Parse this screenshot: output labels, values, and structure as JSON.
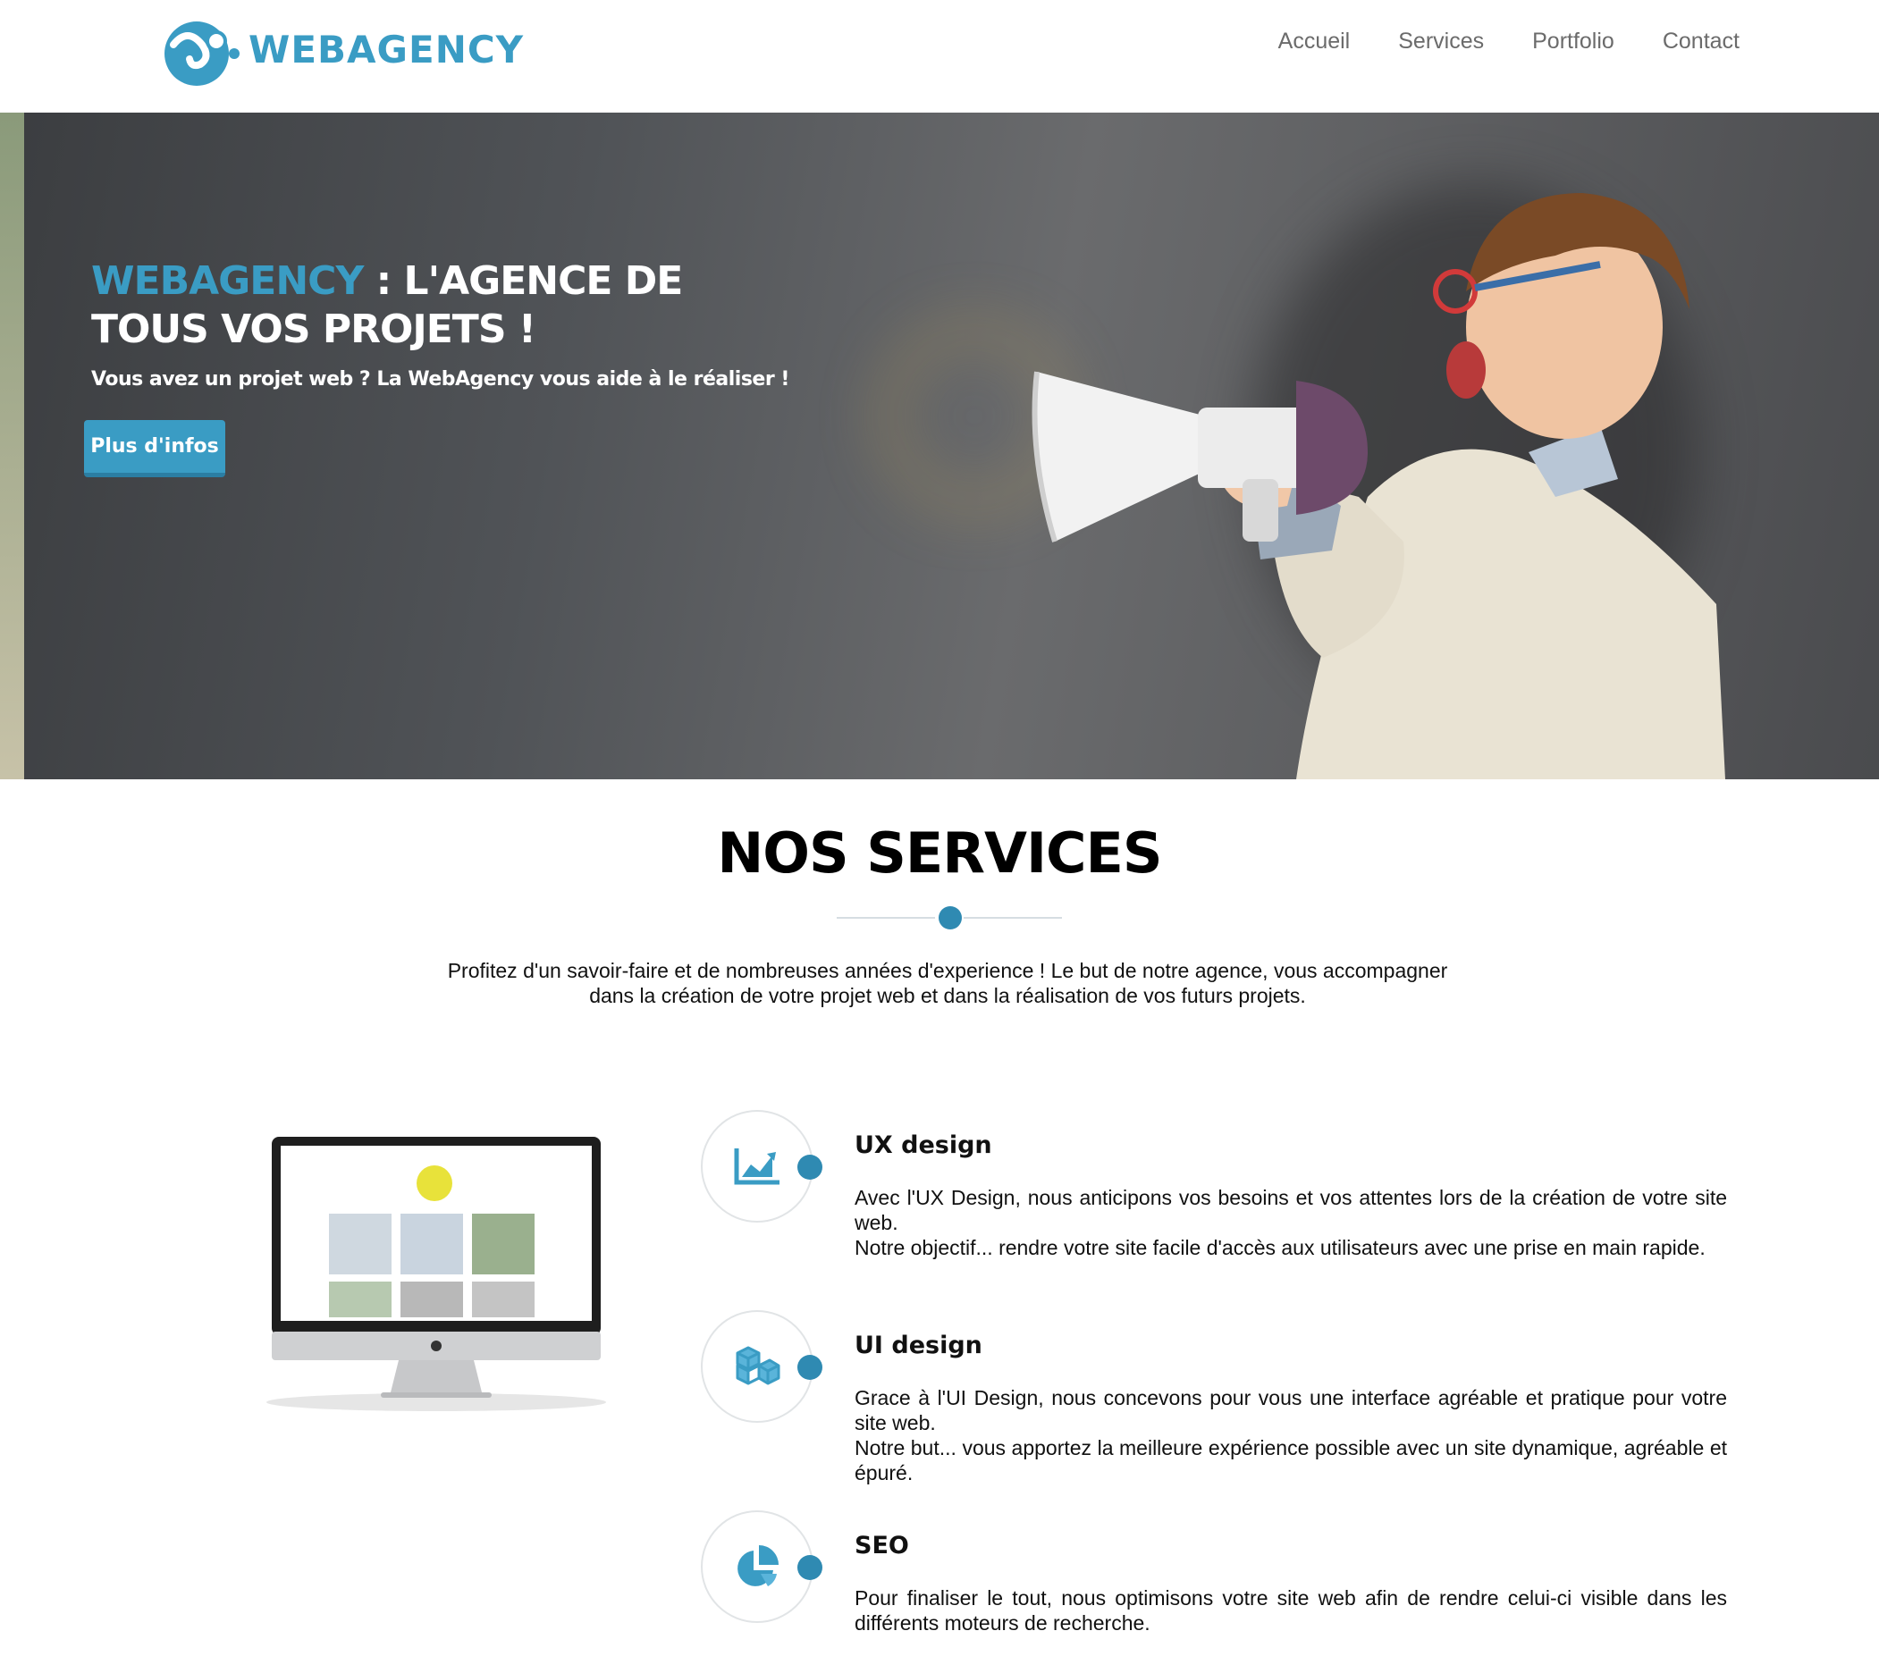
{
  "header": {
    "logo_text": "WEBAGENCY",
    "nav": [
      "Accueil",
      "Services",
      "Portfolio",
      "Contact"
    ]
  },
  "hero": {
    "title_accent": "WEBAGENCY",
    "title_rest": " : L'AGENCE DE TOUS VOS PROJETS !",
    "subtitle": "Vous avez un projet web ? La WebAgency vous aide à le réaliser !",
    "button_label": "Plus d'infos"
  },
  "services": {
    "title": "NOS SERVICES",
    "intro_line1": "Profitez d'un savoir-faire et de nombreuses années d'experience ! Le but de notre agence, vous accompagner",
    "intro_line2": "dans la création de votre projet web et dans la réalisation de vos futurs projets.",
    "items": [
      {
        "icon": "chart-line-icon",
        "title": "UX design",
        "text1": "Avec l'UX Design, nous anticipons vos besoins et vos attentes lors de la création de votre site web.",
        "text2": "Notre objectif... rendre votre site facile d'accès aux utilisateurs avec une prise en main rapide."
      },
      {
        "icon": "cubes-icon",
        "title": "UI design",
        "text1": "Grace à l'UI Design, nous concevons pour vous une interface agréable et pratique pour votre site web.",
        "text2": "Notre but... vous apportez la meilleure expérience possible avec un site dynamique, agréable et épuré."
      },
      {
        "icon": "pie-chart-icon",
        "title": "SEO",
        "text1": "Pour finaliser le tout, nous optimisons votre site web afin de rendre celui-ci visible dans les différents moteurs de recherche.",
        "text2": ""
      }
    ]
  },
  "colors": {
    "accent": "#3a9cc4",
    "accent_dark": "#2f8ab2",
    "nav_text": "#6b6b6b"
  }
}
